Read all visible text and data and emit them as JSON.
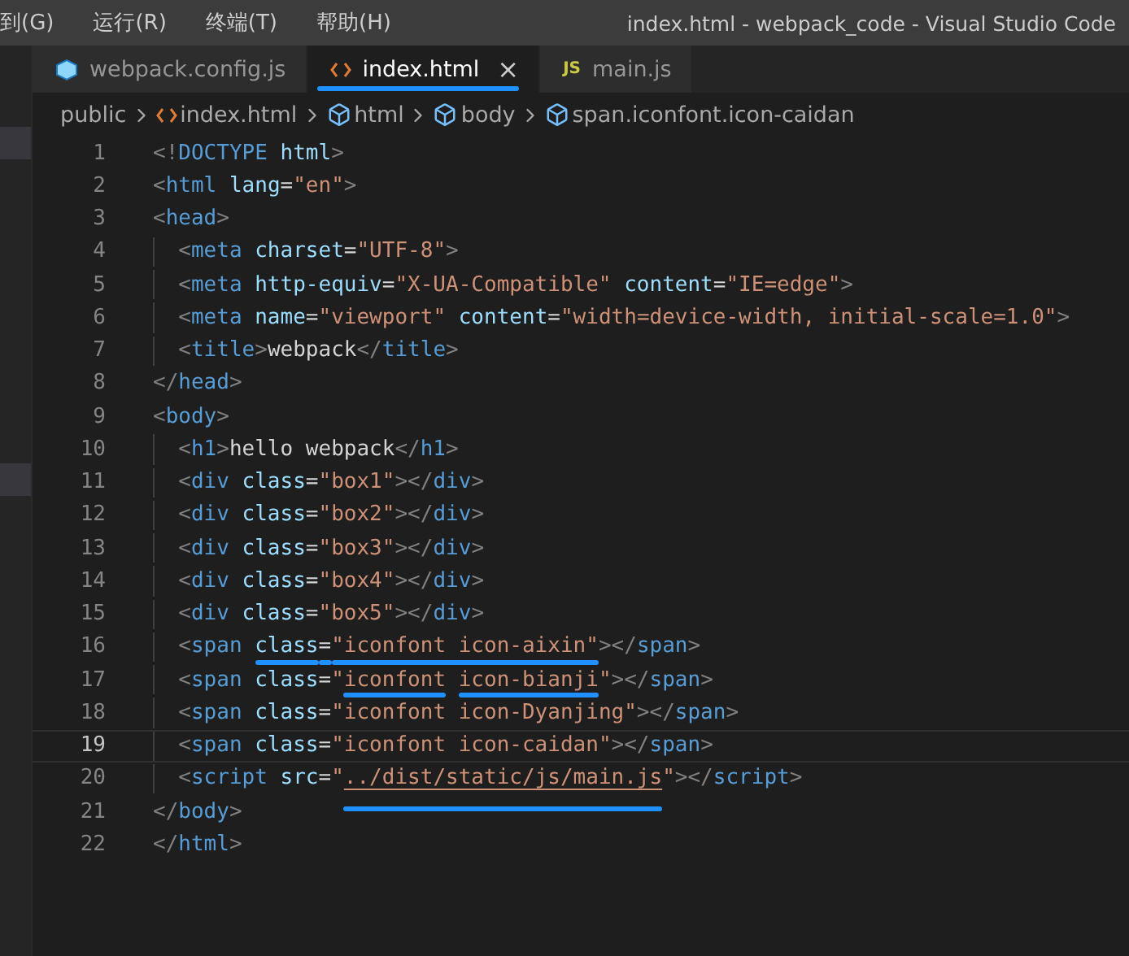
{
  "menu": [
    "到(G)",
    "运行(R)",
    "终端(T)",
    "帮助(H)"
  ],
  "window": {
    "title": "index.html - webpack_code - Visual Studio Code"
  },
  "tabs": [
    {
      "label": "webpack.config.js",
      "kind": "webpack",
      "selected": false,
      "marked": false
    },
    {
      "label": "index.html",
      "kind": "html",
      "selected": true,
      "marked": true,
      "close": "×"
    },
    {
      "label": "main.js",
      "kind": "js",
      "badge": "JS",
      "selected": false,
      "marked": false
    }
  ],
  "breadcrumb": [
    {
      "label": "public",
      "kind": "folder"
    },
    {
      "label": "index.html",
      "kind": "html"
    },
    {
      "label": "html",
      "kind": "element"
    },
    {
      "label": "body",
      "kind": "element"
    },
    {
      "label": "span.iconfont.icon-caidan",
      "kind": "element"
    }
  ],
  "lines": [
    {
      "number": "1",
      "indented": false,
      "current": false,
      "tokens": [
        {
          "kind": "punct",
          "text": "<!"
        },
        {
          "kind": "tag",
          "text": "DOCTYPE"
        },
        {
          "kind": "attr",
          "text": " html"
        },
        {
          "kind": "punct",
          "text": ">"
        }
      ]
    },
    {
      "number": "2",
      "indented": false,
      "current": false,
      "tokens": [
        {
          "kind": "punct",
          "text": "<"
        },
        {
          "kind": "tag",
          "text": "html"
        },
        {
          "kind": "attr",
          "text": " lang"
        },
        {
          "kind": "text",
          "text": "="
        },
        {
          "kind": "str",
          "text": "\"en\""
        },
        {
          "kind": "punct",
          "text": ">"
        }
      ]
    },
    {
      "number": "3",
      "indented": false,
      "current": false,
      "tokens": [
        {
          "kind": "punct",
          "text": "<"
        },
        {
          "kind": "tag",
          "text": "head"
        },
        {
          "kind": "punct",
          "text": ">"
        }
      ]
    },
    {
      "number": "4",
      "indented": true,
      "current": false,
      "tokens": [
        {
          "kind": "punct",
          "text": "<"
        },
        {
          "kind": "tag",
          "text": "meta"
        },
        {
          "kind": "attr",
          "text": " charset"
        },
        {
          "kind": "text",
          "text": "="
        },
        {
          "kind": "str",
          "text": "\"UTF-8\""
        },
        {
          "kind": "punct",
          "text": ">"
        }
      ]
    },
    {
      "number": "5",
      "indented": true,
      "current": false,
      "tokens": [
        {
          "kind": "punct",
          "text": "<"
        },
        {
          "kind": "tag",
          "text": "meta"
        },
        {
          "kind": "attr",
          "text": " http-equiv"
        },
        {
          "kind": "text",
          "text": "="
        },
        {
          "kind": "str",
          "text": "\"X-UA-Compatible\""
        },
        {
          "kind": "attr",
          "text": " content"
        },
        {
          "kind": "text",
          "text": "="
        },
        {
          "kind": "str",
          "text": "\"IE=edge\""
        },
        {
          "kind": "punct",
          "text": ">"
        }
      ]
    },
    {
      "number": "6",
      "indented": true,
      "current": false,
      "tokens": [
        {
          "kind": "punct",
          "text": "<"
        },
        {
          "kind": "tag",
          "text": "meta"
        },
        {
          "kind": "attr",
          "text": " name"
        },
        {
          "kind": "text",
          "text": "="
        },
        {
          "kind": "str",
          "text": "\"viewport\""
        },
        {
          "kind": "attr",
          "text": " content"
        },
        {
          "kind": "text",
          "text": "="
        },
        {
          "kind": "str",
          "text": "\"width=device-width, initial-scale=1.0\""
        },
        {
          "kind": "punct",
          "text": ">"
        }
      ]
    },
    {
      "number": "7",
      "indented": true,
      "current": false,
      "tokens": [
        {
          "kind": "punct",
          "text": "<"
        },
        {
          "kind": "tag",
          "text": "title"
        },
        {
          "kind": "punct",
          "text": ">"
        },
        {
          "kind": "text",
          "text": "webpack"
        },
        {
          "kind": "punct",
          "text": "</"
        },
        {
          "kind": "tag",
          "text": "title"
        },
        {
          "kind": "punct",
          "text": ">"
        }
      ]
    },
    {
      "number": "8",
      "indented": false,
      "current": false,
      "tokens": [
        {
          "kind": "punct",
          "text": "</"
        },
        {
          "kind": "tag",
          "text": "head"
        },
        {
          "kind": "punct",
          "text": ">"
        }
      ]
    },
    {
      "number": "9",
      "indented": false,
      "current": false,
      "tokens": [
        {
          "kind": "punct",
          "text": "<"
        },
        {
          "kind": "tag",
          "text": "body"
        },
        {
          "kind": "punct",
          "text": ">"
        }
      ]
    },
    {
      "number": "10",
      "indented": true,
      "current": false,
      "tokens": [
        {
          "kind": "punct",
          "text": "<"
        },
        {
          "kind": "tag",
          "text": "h1"
        },
        {
          "kind": "punct",
          "text": ">"
        },
        {
          "kind": "text",
          "text": "hello webpack"
        },
        {
          "kind": "punct",
          "text": "</"
        },
        {
          "kind": "tag",
          "text": "h1"
        },
        {
          "kind": "punct",
          "text": ">"
        }
      ]
    },
    {
      "number": "11",
      "indented": true,
      "current": false,
      "tokens": [
        {
          "kind": "punct",
          "text": "<"
        },
        {
          "kind": "tag",
          "text": "div"
        },
        {
          "kind": "attr",
          "text": " class"
        },
        {
          "kind": "text",
          "text": "="
        },
        {
          "kind": "str",
          "text": "\"box1\""
        },
        {
          "kind": "punct",
          "text": "></"
        },
        {
          "kind": "tag",
          "text": "div"
        },
        {
          "kind": "punct",
          "text": ">"
        }
      ]
    },
    {
      "number": "12",
      "indented": true,
      "current": false,
      "tokens": [
        {
          "kind": "punct",
          "text": "<"
        },
        {
          "kind": "tag",
          "text": "div"
        },
        {
          "kind": "attr",
          "text": " class"
        },
        {
          "kind": "text",
          "text": "="
        },
        {
          "kind": "str",
          "text": "\"box2\""
        },
        {
          "kind": "punct",
          "text": "></"
        },
        {
          "kind": "tag",
          "text": "div"
        },
        {
          "kind": "punct",
          "text": ">"
        }
      ]
    },
    {
      "number": "13",
      "indented": true,
      "current": false,
      "tokens": [
        {
          "kind": "punct",
          "text": "<"
        },
        {
          "kind": "tag",
          "text": "div"
        },
        {
          "kind": "attr",
          "text": " class"
        },
        {
          "kind": "text",
          "text": "="
        },
        {
          "kind": "str",
          "text": "\"box3\""
        },
        {
          "kind": "punct",
          "text": "></"
        },
        {
          "kind": "tag",
          "text": "div"
        },
        {
          "kind": "punct",
          "text": ">"
        }
      ]
    },
    {
      "number": "14",
      "indented": true,
      "current": false,
      "tokens": [
        {
          "kind": "punct",
          "text": "<"
        },
        {
          "kind": "tag",
          "text": "div"
        },
        {
          "kind": "attr",
          "text": " class"
        },
        {
          "kind": "text",
          "text": "="
        },
        {
          "kind": "str",
          "text": "\"box4\""
        },
        {
          "kind": "punct",
          "text": "></"
        },
        {
          "kind": "tag",
          "text": "div"
        },
        {
          "kind": "punct",
          "text": ">"
        }
      ]
    },
    {
      "number": "15",
      "indented": true,
      "current": false,
      "tokens": [
        {
          "kind": "punct",
          "text": "<"
        },
        {
          "kind": "tag",
          "text": "div"
        },
        {
          "kind": "attr",
          "text": " class"
        },
        {
          "kind": "text",
          "text": "="
        },
        {
          "kind": "str",
          "text": "\"box5\""
        },
        {
          "kind": "punct",
          "text": "></"
        },
        {
          "kind": "tag",
          "text": "div"
        },
        {
          "kind": "punct",
          "text": ">"
        }
      ]
    },
    {
      "number": "16",
      "indented": true,
      "current": false,
      "tokens": [
        {
          "kind": "punct",
          "text": "<"
        },
        {
          "kind": "tag",
          "text": "span"
        },
        {
          "kind": "attr",
          "text": " class",
          "marked": true
        },
        {
          "kind": "text",
          "text": "=",
          "marked": true
        },
        {
          "kind": "str",
          "text": "\"iconfont icon-aixin\"",
          "marked": true
        },
        {
          "kind": "punct",
          "text": "></"
        },
        {
          "kind": "tag",
          "text": "span"
        },
        {
          "kind": "punct",
          "text": ">"
        }
      ]
    },
    {
      "number": "17",
      "indented": true,
      "current": false,
      "tokens": [
        {
          "kind": "punct",
          "text": "<"
        },
        {
          "kind": "tag",
          "text": "span"
        },
        {
          "kind": "attr",
          "text": " class"
        },
        {
          "kind": "text",
          "text": "="
        },
        {
          "kind": "str",
          "text": "\""
        },
        {
          "kind": "str",
          "text": "iconfont",
          "marked": true
        },
        {
          "kind": "str",
          "text": " icon-bianji",
          "marked": true
        },
        {
          "kind": "str",
          "text": "\""
        },
        {
          "kind": "punct",
          "text": "></"
        },
        {
          "kind": "tag",
          "text": "span"
        },
        {
          "kind": "punct",
          "text": ">"
        }
      ]
    },
    {
      "number": "18",
      "indented": true,
      "current": false,
      "tokens": [
        {
          "kind": "punct",
          "text": "<"
        },
        {
          "kind": "tag",
          "text": "span"
        },
        {
          "kind": "attr",
          "text": " class"
        },
        {
          "kind": "text",
          "text": "="
        },
        {
          "kind": "str",
          "text": "\"iconfont icon-Dyanjing\""
        },
        {
          "kind": "punct",
          "text": "></"
        },
        {
          "kind": "tag",
          "text": "span"
        },
        {
          "kind": "punct",
          "text": ">"
        }
      ]
    },
    {
      "number": "19",
      "indented": true,
      "current": true,
      "tokens": [
        {
          "kind": "punct",
          "text": "<"
        },
        {
          "kind": "tag",
          "text": "span"
        },
        {
          "kind": "attr",
          "text": " class"
        },
        {
          "kind": "text",
          "text": "="
        },
        {
          "kind": "str",
          "text": "\"iconfont icon-caidan\""
        },
        {
          "kind": "punct",
          "text": "></"
        },
        {
          "kind": "tag",
          "text": "span"
        },
        {
          "kind": "punct",
          "text": ">"
        }
      ]
    },
    {
      "number": "20",
      "indented": true,
      "current": false,
      "tokens": [
        {
          "kind": "punct",
          "text": "<"
        },
        {
          "kind": "tag",
          "text": "script"
        },
        {
          "kind": "attr",
          "text": " src"
        },
        {
          "kind": "text",
          "text": "="
        },
        {
          "kind": "str",
          "text": "\""
        },
        {
          "kind": "str",
          "text": "../dist/static/js/main.js",
          "marked": true,
          "link": true
        },
        {
          "kind": "str",
          "text": "\""
        },
        {
          "kind": "punct",
          "text": "></"
        },
        {
          "kind": "tag",
          "text": "script"
        },
        {
          "kind": "punct",
          "text": ">"
        }
      ]
    },
    {
      "number": "21",
      "indented": false,
      "current": false,
      "tokens": [
        {
          "kind": "punct",
          "text": "</"
        },
        {
          "kind": "tag",
          "text": "body"
        },
        {
          "kind": "punct",
          "text": ">"
        }
      ]
    },
    {
      "number": "22",
      "indented": false,
      "current": false,
      "tokens": [
        {
          "kind": "punct",
          "text": "</"
        },
        {
          "kind": "tag",
          "text": "html"
        },
        {
          "kind": "punct",
          "text": ">"
        }
      ]
    }
  ]
}
